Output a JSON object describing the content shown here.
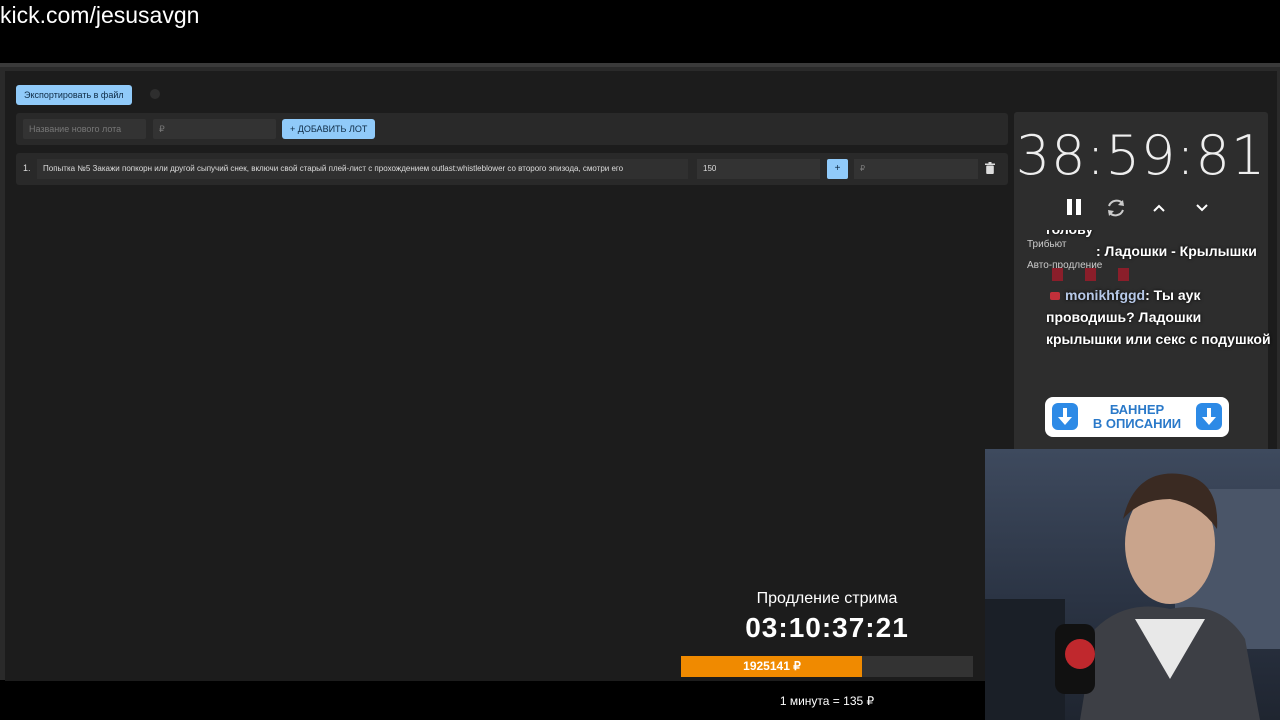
{
  "stream_url": "kick.com/jesusavgn",
  "toolbar": {
    "export_label": "Экспортировать в файл"
  },
  "new_lot": {
    "name_placeholder": "Название нового лота",
    "amount_placeholder": "₽",
    "add_label": "+ ДОБАВИТЬ ЛОТ"
  },
  "lots": [
    {
      "number": "1.",
      "name": "Попытка №5 Закажи попкорн или другой сыпучий снек, включи свой старый плей-лист с прохождением outlast:whistleblower со второго эпизода, смотри его",
      "amount": "150",
      "plus_label": "+",
      "add_placeholder": "₽"
    }
  ],
  "timer": {
    "value": "38:59:81"
  },
  "options": {
    "tributes_label": "Трибьют",
    "auto_label": "Авто-продление"
  },
  "chat": {
    "line0": "голову",
    "msg1_text": ": Ладошки - Крылышки",
    "msg2_user": "monikhfggd",
    "msg2_text": ": Ты аук проводишь? Ладошки крылышки или секс с подушкой"
  },
  "banner": {
    "line1": "БАННЕР",
    "line2": "В ОПИСАНИИ"
  },
  "extension": {
    "label": "Продление стрима",
    "timer": "03:10:37:21",
    "amount_text": "1925141 ₽",
    "progress_fraction": 0.62,
    "rate": "1 минута = 135 ₽"
  },
  "colors": {
    "accent": "#90caf9",
    "progress": "#f08a00"
  }
}
